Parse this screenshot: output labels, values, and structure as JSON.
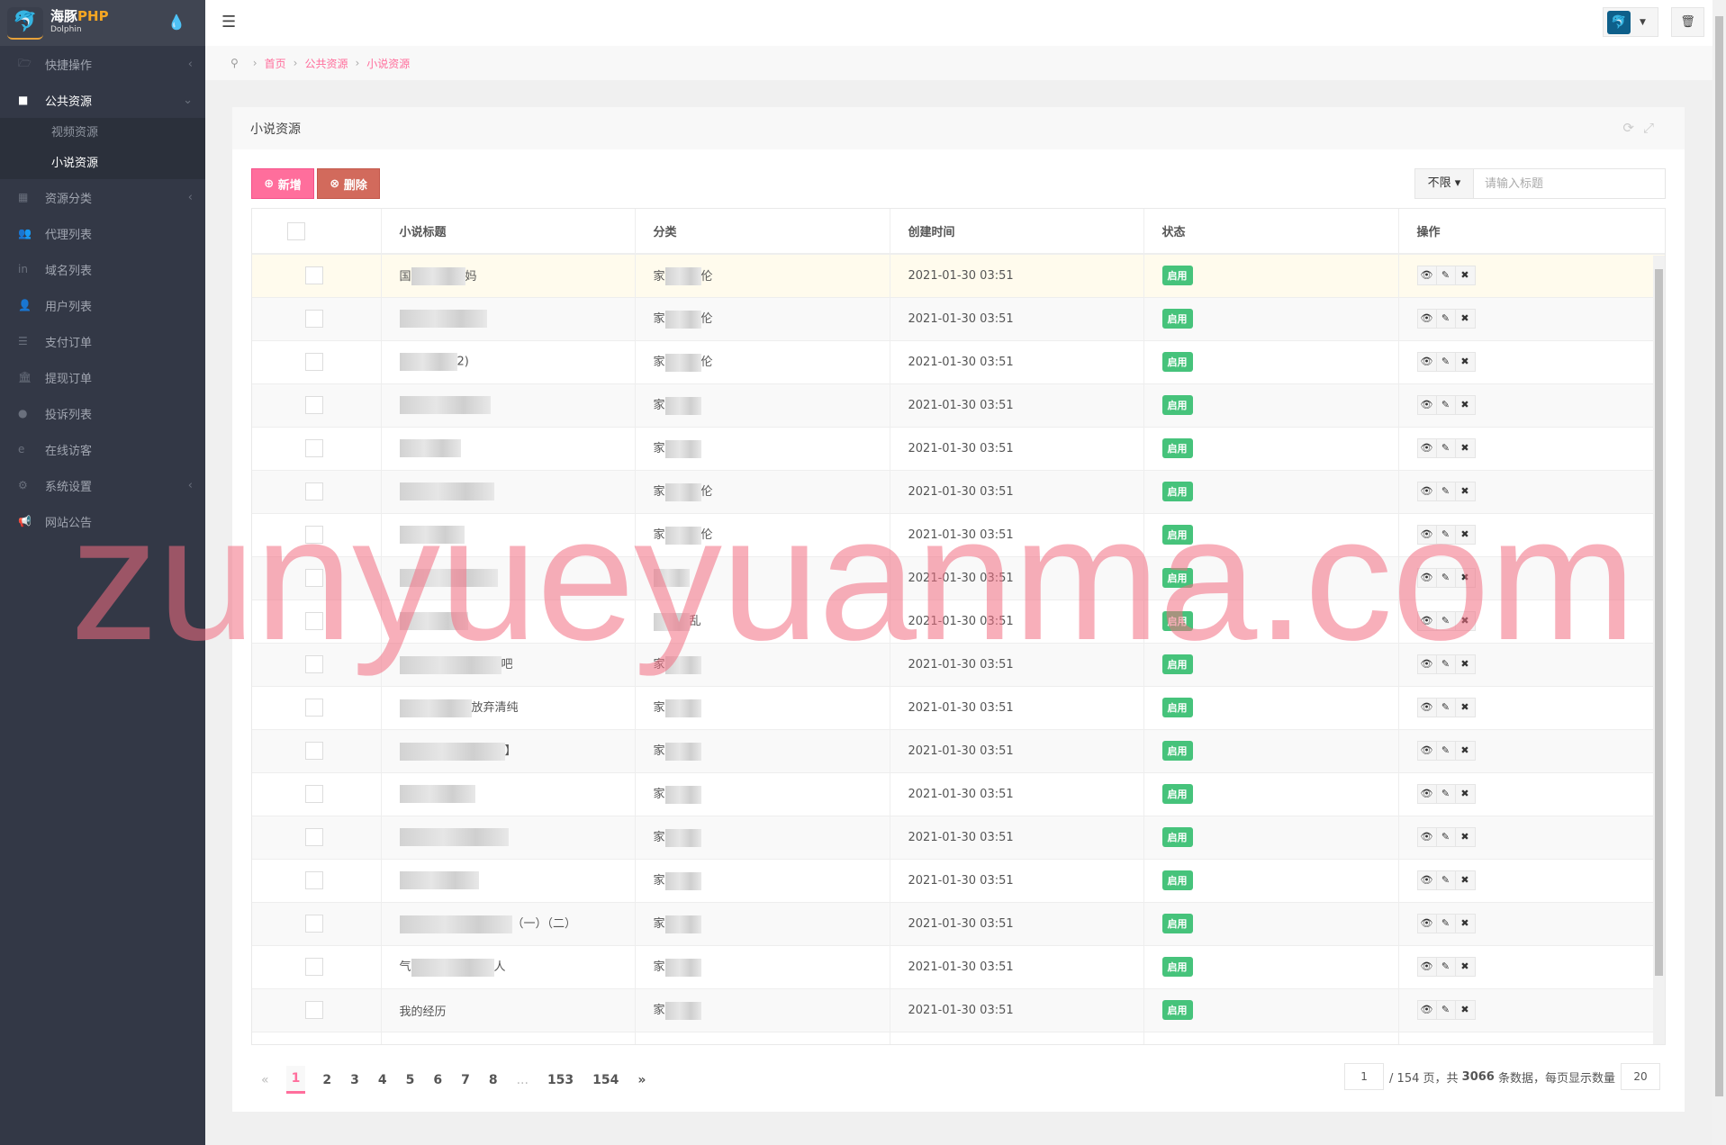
{
  "brand": {
    "name_cn": "海豚",
    "name_en": "PHP",
    "sub": "Dolphin"
  },
  "sidebar": {
    "items": [
      {
        "label": "快捷操作",
        "icon": "folder-open-icon",
        "arrow": "‹"
      },
      {
        "label": "公共资源",
        "icon": "video-camera-icon",
        "arrow": "⌄",
        "active": true,
        "children": [
          {
            "label": "视频资源"
          },
          {
            "label": "小说资源",
            "active": true
          }
        ]
      },
      {
        "label": "资源分类",
        "icon": "th-large-icon",
        "arrow": "‹"
      },
      {
        "label": "代理列表",
        "icon": "users-icon"
      },
      {
        "label": "域名列表",
        "icon": "linkedin-icon"
      },
      {
        "label": "用户列表",
        "icon": "user-icon"
      },
      {
        "label": "支付订单",
        "icon": "database-icon"
      },
      {
        "label": "提现订单",
        "icon": "bank-icon"
      },
      {
        "label": "投诉列表",
        "icon": "exclamation-circle-icon"
      },
      {
        "label": "在线访客",
        "icon": "internet-explorer-icon"
      },
      {
        "label": "系统设置",
        "icon": "gear-icon",
        "arrow": "‹"
      },
      {
        "label": "网站公告",
        "icon": "bullhorn-icon"
      }
    ]
  },
  "breadcrumb": [
    "首页",
    "公共资源",
    "小说资源"
  ],
  "panel": {
    "title": "小说资源"
  },
  "toolbar": {
    "add_label": "新增",
    "delete_label": "删除",
    "filter_value": "不限",
    "search_placeholder": "请输入标题"
  },
  "table": {
    "columns": [
      "小说标题",
      "分类",
      "创建时间",
      "状态",
      "操作"
    ],
    "rows": [
      {
        "title": [
          "国",
          "妈"
        ],
        "cat": [
          "家",
          "伦"
        ],
        "time": "2021-01-30 03:51",
        "status": "启用"
      },
      {
        "title": [
          "",
          ""
        ],
        "cat": [
          "家",
          "伦"
        ],
        "time": "2021-01-30 03:51",
        "status": "启用"
      },
      {
        "title": [
          "",
          "2)"
        ],
        "cat": [
          "家",
          "伦"
        ],
        "time": "2021-01-30 03:51",
        "status": "启用"
      },
      {
        "title": [
          "",
          ""
        ],
        "cat": [
          "家",
          ""
        ],
        "time": "2021-01-30 03:51",
        "status": "启用"
      },
      {
        "title": [
          "",
          ""
        ],
        "cat": [
          "家",
          ""
        ],
        "time": "2021-01-30 03:51",
        "status": "启用"
      },
      {
        "title": [
          "",
          ""
        ],
        "cat": [
          "家",
          "伦"
        ],
        "time": "2021-01-30 03:51",
        "status": "启用"
      },
      {
        "title": [
          "",
          ""
        ],
        "cat": [
          "家",
          "伦"
        ],
        "time": "2021-01-30 03:51",
        "status": "启用"
      },
      {
        "title": [
          "",
          ""
        ],
        "cat": [
          "",
          ""
        ],
        "time": "2021-01-30 03:51",
        "status": "启用"
      },
      {
        "title": [
          "",
          ""
        ],
        "cat": [
          "",
          "乱"
        ],
        "time": "2021-01-30 03:51",
        "status": "启用"
      },
      {
        "title": [
          "",
          "吧"
        ],
        "cat": [
          "家",
          ""
        ],
        "time": "2021-01-30 03:51",
        "status": "启用"
      },
      {
        "title": [
          "",
          "放弃清纯"
        ],
        "cat": [
          "家",
          ""
        ],
        "time": "2021-01-30 03:51",
        "status": "启用"
      },
      {
        "title": [
          "",
          "】"
        ],
        "cat": [
          "家",
          ""
        ],
        "time": "2021-01-30 03:51",
        "status": "启用"
      },
      {
        "title": [
          "",
          ""
        ],
        "cat": [
          "家",
          ""
        ],
        "time": "2021-01-30 03:51",
        "status": "启用"
      },
      {
        "title": [
          "",
          ""
        ],
        "cat": [
          "家",
          ""
        ],
        "time": "2021-01-30 03:51",
        "status": "启用"
      },
      {
        "title": [
          "",
          ""
        ],
        "cat": [
          "家",
          ""
        ],
        "time": "2021-01-30 03:51",
        "status": "启用"
      },
      {
        "title": [
          "",
          "（一）（二）"
        ],
        "cat": [
          "家",
          ""
        ],
        "time": "2021-01-30 03:51",
        "status": "启用"
      },
      {
        "title": [
          "气",
          "人"
        ],
        "cat": [
          "家",
          ""
        ],
        "time": "2021-01-30 03:51",
        "status": "启用"
      },
      {
        "title": [
          "我的经历",
          ""
        ],
        "cat": [
          "家",
          ""
        ],
        "time": "2021-01-30 03:51",
        "status": "启用"
      },
      {
        "title": [
          "",
          ""
        ],
        "cat": [
          "",
          ""
        ],
        "time": "",
        "status": ""
      }
    ]
  },
  "pagination": {
    "prev": "«",
    "pages": [
      "1",
      "2",
      "3",
      "4",
      "5",
      "6",
      "7",
      "8",
      "...",
      "153",
      "154"
    ],
    "current": "1",
    "next": "»",
    "page_input": "1",
    "total_pages_text": "/ 154 页，共",
    "total_count": "3066",
    "count_suffix": "条数据，每页显示数量",
    "per_page": "20"
  },
  "colors": {
    "accent": "#ff6e9c",
    "danger": "#d26a5c",
    "success": "#46c37b",
    "sidebar": "#333846"
  },
  "watermark": "zunyueyuanma.com"
}
